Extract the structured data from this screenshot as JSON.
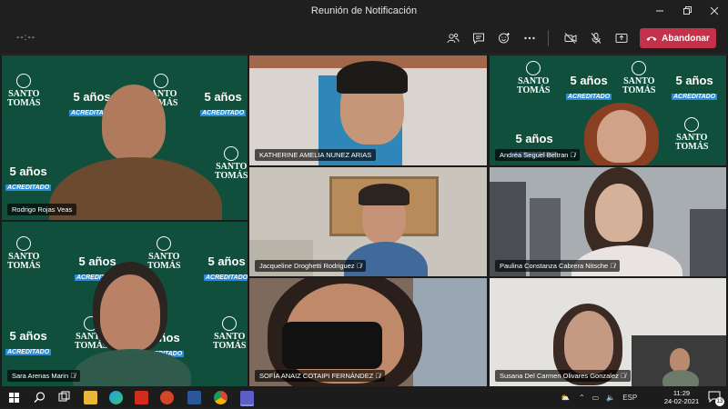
{
  "window": {
    "title": "Reunión de Notificación",
    "minimize_icon": "minimize-icon",
    "restore_icon": "restore-icon",
    "close_icon": "close-icon"
  },
  "meeting_toolbar": {
    "timer": "--:--",
    "buttons": [
      "participants-icon",
      "chat-icon",
      "reactions-icon",
      "more-options-icon",
      "camera-off-icon",
      "mic-off-icon",
      "share-screen-icon"
    ],
    "leave_label": "Abandonar",
    "leave_color": "#c4314b"
  },
  "participants": [
    {
      "name": "Rodrigo Rojas Veas",
      "muted": false
    },
    {
      "name": "KATHERINE AMELIA NUNEZ ARIAS",
      "muted": false
    },
    {
      "name": "Andrea Seguel Beltran",
      "muted": true
    },
    {
      "name": "Jacqueline Droghetti Rodriguez",
      "muted": true
    },
    {
      "name": "Paulina Constanza Cabrera Nitsche",
      "muted": true
    },
    {
      "name": "Sara Arenas Marin",
      "muted": true
    },
    {
      "name": "SOFÍA ANAIZ COTAIPI FERNÁNDEZ",
      "muted": true
    },
    {
      "name": "Susana Del Carmen Olivares Gonzalez",
      "muted": true
    }
  ],
  "background_branding": {
    "logo_line1": "SANTO",
    "logo_line2": "TOMÁS",
    "years": "5 años",
    "accredited": "ACREDITADO",
    "brand_color": "#0f4f3c",
    "accent_color": "#2d8bd6"
  },
  "taskbar": {
    "apps": [
      "windows-start-icon",
      "search-icon",
      "task-view-icon",
      "file-explorer-icon",
      "edge-icon",
      "acrobat-icon",
      "powerpoint-icon",
      "word-icon",
      "chrome-icon",
      "teams-icon"
    ],
    "language": "ESP",
    "time": "11:29",
    "date": "24-02-2021",
    "notification_count": "13"
  }
}
